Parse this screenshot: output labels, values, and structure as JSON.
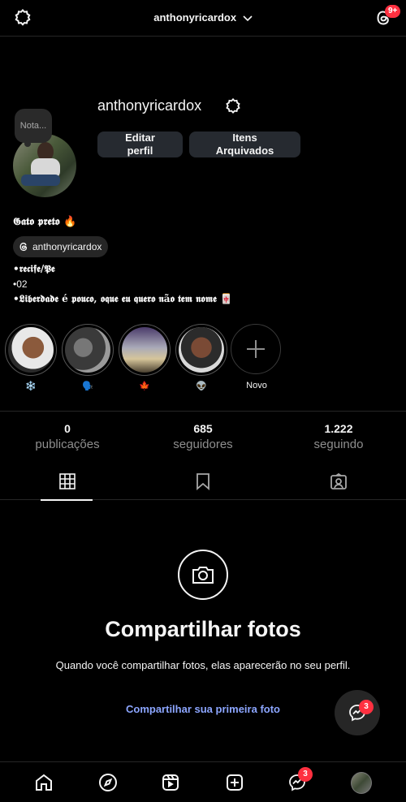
{
  "header": {
    "account": "anthonyricardox",
    "threads_badge": "9+"
  },
  "profile": {
    "note": "Nota...",
    "username": "anthonyricardox",
    "edit_label": "Editar perfil",
    "archive_label": "Itens Arquivados",
    "bio_name": "𝕲𝖆𝖙𝖔 𝖕𝖗𝖊𝖙𝖔 🔥",
    "threads_handle": "anthonyricardox",
    "bio_lines": [
      "•𝖗𝖊𝖈𝖎𝖋𝖊/𝕻𝖊",
      "•02",
      "•𝕷𝖎𝖇𝖊𝖗𝖉𝖆𝖉𝖊 é 𝖕𝖔𝖚𝖈𝖔, 𝖔𝖖𝖚𝖊 𝖊𝖚 𝖖𝖚𝖊𝖗𝖔 𝖓ã𝖔 𝖙𝖊𝖒 𝖓𝖔𝖒𝖊 🀄"
    ]
  },
  "highlights": [
    {
      "label": "❄️"
    },
    {
      "label": "🗣️"
    },
    {
      "label": "🍁"
    },
    {
      "label": "👽"
    },
    {
      "label": "Novo"
    }
  ],
  "stats": [
    {
      "num": "0",
      "label": "publicações"
    },
    {
      "num": "685",
      "label": "seguidores"
    },
    {
      "num": "1.222",
      "label": "seguindo"
    }
  ],
  "tabs": [
    "grid-icon",
    "saved-icon",
    "tagged-icon"
  ],
  "empty": {
    "title": "Compartilhar fotos",
    "desc": "Quando você compartilhar fotos, elas aparecerão no seu perfil.",
    "link": "Compartilhar sua primeira foto"
  },
  "fab_badge": "3",
  "nav": {
    "messages_badge": "3"
  },
  "colors": {
    "accent_link": "#8ca6ff",
    "badge": "#ff3040"
  }
}
